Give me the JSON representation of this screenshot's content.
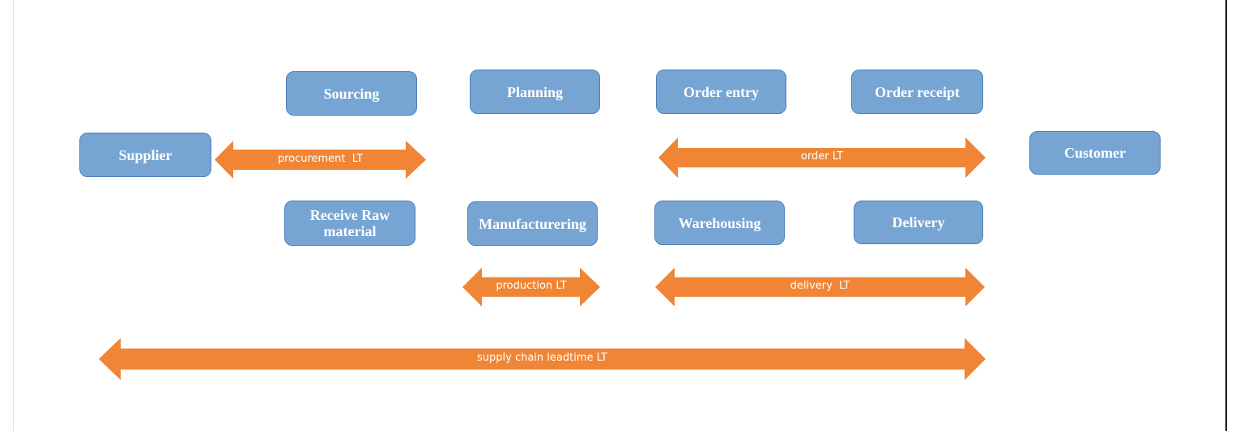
{
  "diagram": {
    "title": "",
    "colors": {
      "box_fill": "#77a5d3",
      "box_border": "#4f7fb8",
      "box_text": "#ffffff",
      "arrow_fill": "#ef8535",
      "arrow_text": "#ffffff"
    },
    "nodes": {
      "supplier": "Supplier",
      "sourcing": "Sourcing",
      "planning": "Planning",
      "order_entry": "Order entry",
      "order_receipt": "Order receipt",
      "customer": "Customer",
      "receive_raw_line1": "Receive Raw",
      "receive_raw_line2": "material",
      "manufacturing": "Manufacturering",
      "warehousing": "Warehousing",
      "delivery": "Delivery"
    },
    "arrows": {
      "procurement": "procurement  LT",
      "order": "order LT",
      "production": "production LT",
      "delivery": "delivery  LT",
      "supply_chain": "supply chain leadtime LT"
    }
  }
}
